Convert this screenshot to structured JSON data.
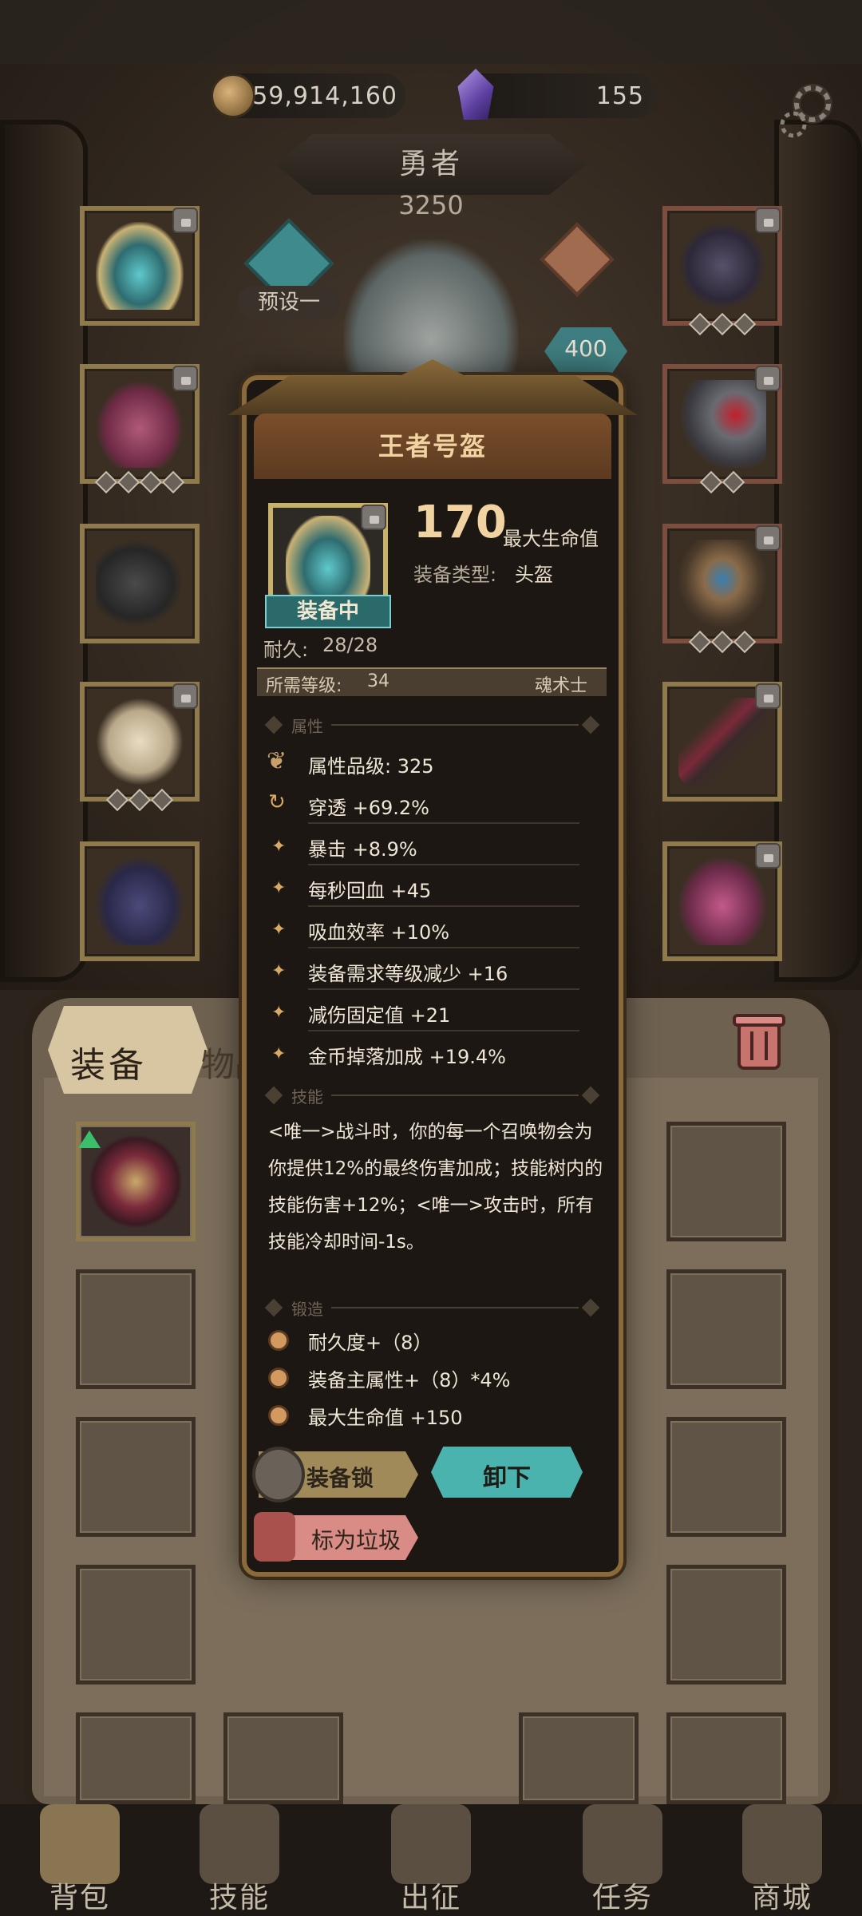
{
  "currency": {
    "gold": "59,914,160",
    "gems": "155"
  },
  "hero": {
    "name": "勇者",
    "power": "3250",
    "preset_label": "预设一",
    "rank_value": "400"
  },
  "popup": {
    "title": "王者号盔",
    "power": "170",
    "power_label": "最大生命值",
    "type_label": "装备类型:",
    "type_value": "头盔",
    "equipped_label": "装备中",
    "durability_label": "耐久:",
    "durability_value": "28/28",
    "req_label": "所需等级:",
    "req_value": "34",
    "req_class": "魂术士",
    "section_attr": "属性",
    "section_skill": "技能",
    "section_forge": "锻造",
    "attributes": [
      "属性品级: 325",
      "穿透 +69.2%",
      "暴击 +8.9%",
      "每秒回血 +45",
      "吸血效率 +10%",
      "装备需求等级减少 +16",
      "减伤固定值 +21",
      "金币掉落加成 +19.4%"
    ],
    "skill_text": "<唯一>战斗时，你的每一个召唤物会为你提供12%的最终伤害加成；技能树内的技能伤害+12%；<唯一>攻击时，所有技能冷却时间-1s。",
    "forge": [
      "耐久度+（8）",
      "装备主属性+（8）*4%",
      "最大生命值 +150"
    ],
    "btn_lock": "装备锁",
    "btn_unequip": "卸下",
    "btn_trash": "标为垃圾"
  },
  "tabs": {
    "equip": "装备",
    "items": "物品"
  },
  "nav": [
    {
      "label": "背包",
      "icon": "backpack-icon"
    },
    {
      "label": "技能",
      "icon": "skill-book-icon"
    },
    {
      "label": "出征",
      "icon": "sword-icon"
    },
    {
      "label": "任务",
      "icon": "scroll-icon"
    },
    {
      "label": "商城",
      "icon": "shop-icon"
    }
  ],
  "colors": {
    "accent": "#f1d3a2",
    "teal": "#4bb3ad",
    "gold_frame": "#8e7a4c",
    "trash_pink": "#d98b86"
  }
}
